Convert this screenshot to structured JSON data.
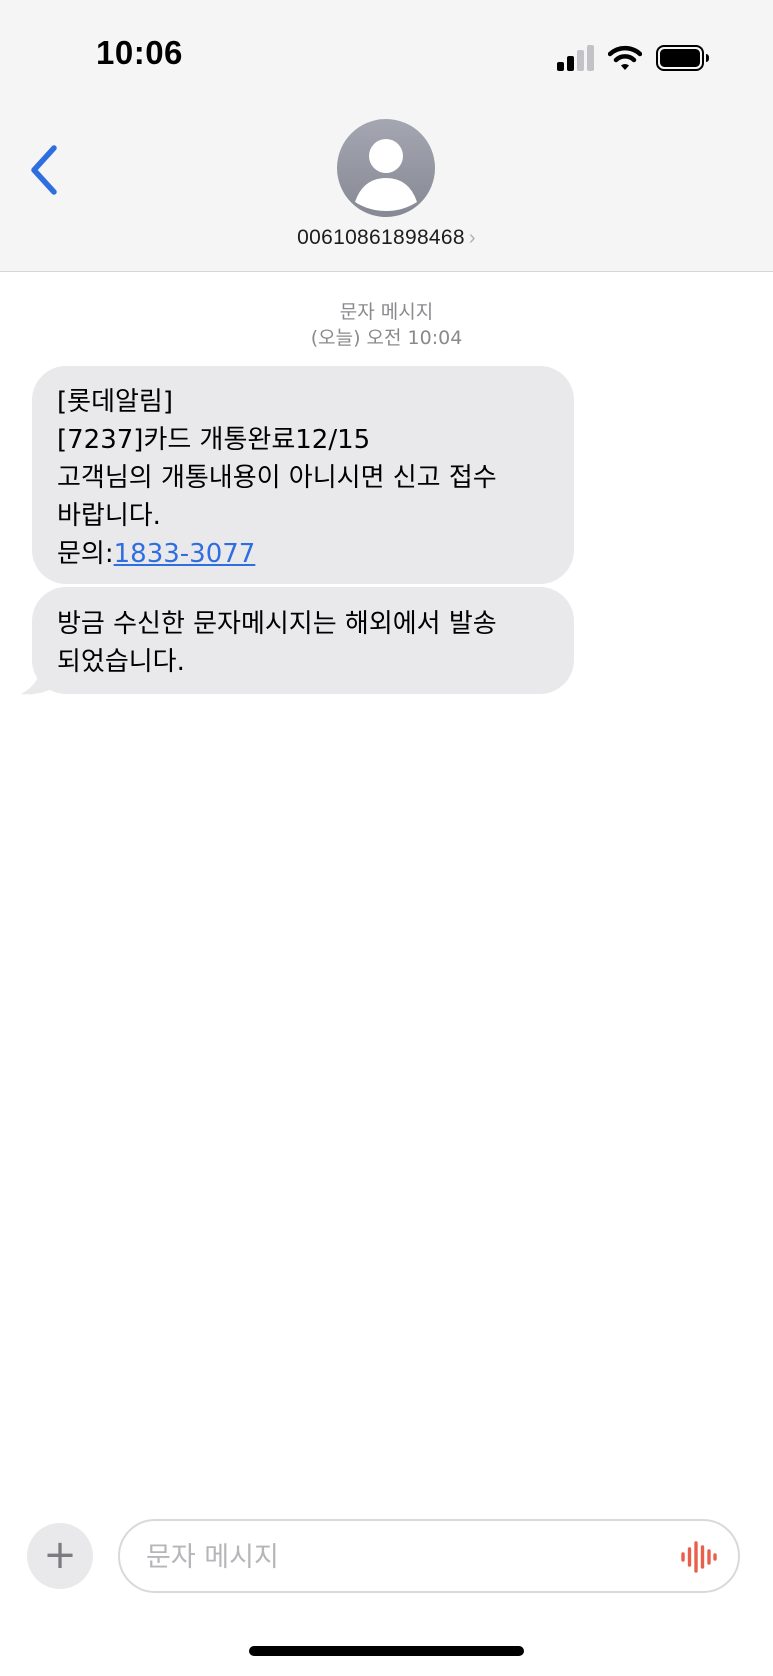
{
  "status_bar": {
    "time": "10:06",
    "icons": [
      "cellular-signal-icon",
      "wifi-icon",
      "battery-icon"
    ]
  },
  "header": {
    "back_icon": "chevron-left-icon",
    "avatar_icon": "person-silhouette-icon",
    "contact_number": "00610861898468",
    "contact_chevron": "›"
  },
  "thread": {
    "message_type": "문자 메시지",
    "timestamp": "(오늘) 오전 10:04"
  },
  "messages": [
    {
      "lines": [
        "[롯데알림]",
        "[7237]카드 개통완료12/15",
        "고객님의 개통내용이 아니시면 신고 접수",
        "바랍니다."
      ],
      "inquiry_label": "문의:",
      "phone_link": "1833-3077"
    },
    {
      "lines": [
        "방금 수신한 문자메시지는 해외에서 발송",
        "되었습니다."
      ]
    }
  ],
  "composer": {
    "plus_label": "+",
    "placeholder": "문자 메시지",
    "value": "",
    "voice_icon": "audio-waveform-icon"
  },
  "colors": {
    "accent": "#2f6ee0",
    "bubble_received": "#e9e9eb",
    "header_background": "#f5f5f5",
    "voice_icon": "#e8604c"
  }
}
